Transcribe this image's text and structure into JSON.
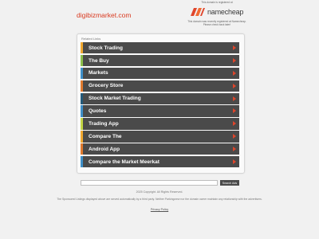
{
  "header": {
    "domain": "digibizmarket.com",
    "registered_note": "This domain is registered at",
    "registrar_name": "namecheap",
    "registrar_note": "This domain was recently registered at Namecheap. Please check back later!"
  },
  "panel": {
    "title": "Related Links",
    "links": [
      {
        "label": "Stock Trading",
        "color": "#f0a830"
      },
      {
        "label": "The Buy",
        "color": "#8cc04b"
      },
      {
        "label": "Markets",
        "color": "#3e8fc7"
      },
      {
        "label": "Grocery Store",
        "color": "#e07a2e"
      },
      {
        "label": "Stock Market Trading",
        "color": "#245a7a"
      },
      {
        "label": "Quotes",
        "color": "#3e8fc7"
      },
      {
        "label": "Trading App",
        "color": "#c2d445"
      },
      {
        "label": "Compare The",
        "color": "#f0a830"
      },
      {
        "label": "Android App",
        "color": "#e07a2e"
      },
      {
        "label": "Compare the Market Meerkat",
        "color": "#3e8fc7"
      }
    ],
    "arrow_icon": "arrow-right-icon",
    "arrow_color": "#e0452b"
  },
  "search": {
    "value": "",
    "button_label": "Search Ads"
  },
  "footer": {
    "copyright": "2025 Copyright. All Rights Reserved.",
    "disclaimer": "The Sponsored Listings displayed above are served automatically by a third party. Neither Parkingcrew nor the domain owner maintain any relationship with the advertisers.",
    "privacy_label": "Privacy Policy"
  }
}
